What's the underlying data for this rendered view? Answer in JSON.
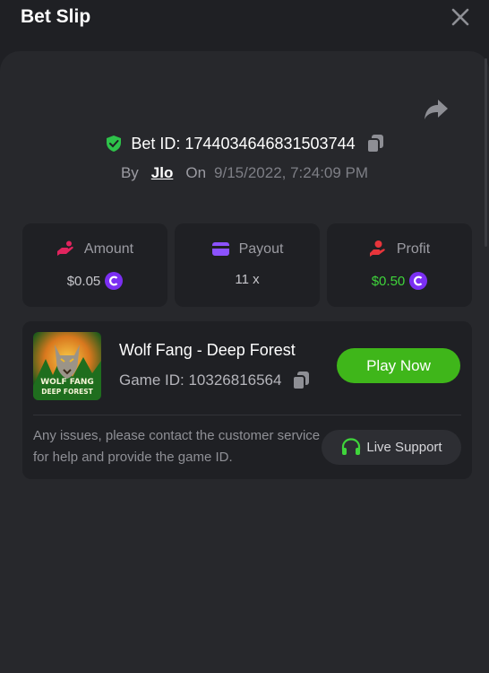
{
  "header": {
    "title": "Bet Slip"
  },
  "bet": {
    "id_label": "Bet ID: 1744034646831503744",
    "by_label": "By",
    "user": "Jlo",
    "on_label": "On",
    "date": "9/15/2022, 7:24:09 PM"
  },
  "stats": {
    "amount": {
      "label": "Amount",
      "value": "$0.05"
    },
    "payout": {
      "label": "Payout",
      "value": "11 x"
    },
    "profit": {
      "label": "Profit",
      "value": "$0.50"
    }
  },
  "game": {
    "name": "Wolf Fang - Deep Forest",
    "id_label": "Game ID: 10326816564",
    "thumb_text_line1": "WOLF FANG",
    "thumb_text_line2": "DEEP FOREST",
    "play_label": "Play Now",
    "issues_text": "Any issues, please contact the customer service for help and provide the game ID.",
    "support_label": "Live Support"
  },
  "colors": {
    "background": "#1f2024",
    "panel": "#27282c",
    "accent_green": "#3fb61a",
    "profit_green": "#3fd43b",
    "coin_purple": "#7b2ff2",
    "amount_icon": "#e0245e",
    "payout_icon": "#8c52ff",
    "profit_icon": "#e8353b"
  }
}
